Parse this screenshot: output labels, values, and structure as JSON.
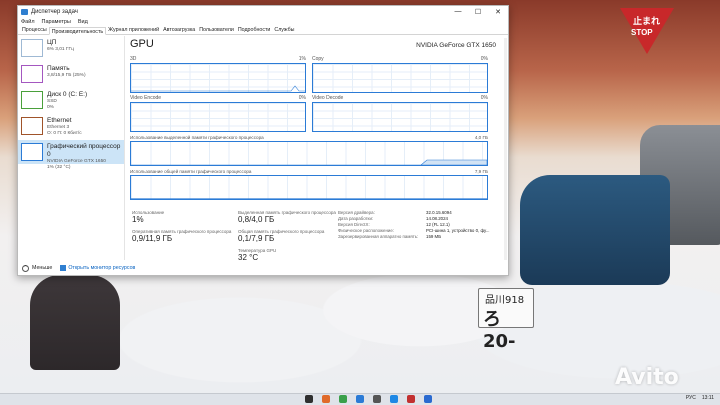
{
  "window": {
    "title": "Диспетчер задач"
  },
  "menu": [
    "Файл",
    "Параметры",
    "Вид"
  ],
  "tabs": [
    "Процессы",
    "Производительность",
    "Журнал приложений",
    "Автозагрузка",
    "Пользователи",
    "Подробности",
    "Службы"
  ],
  "sidebar": {
    "items": [
      {
        "name": "ЦП",
        "detail": "6% 3,01 ГГц"
      },
      {
        "name": "Память",
        "detail": "3,8/15,9 ГБ (25%)"
      },
      {
        "name": "Диск 0 (C: E:)",
        "detail": "SSD",
        "detail2": "0%"
      },
      {
        "name": "Ethernet",
        "detail": "Ethernet 3",
        "detail2": "О: 0 П: 0 Кбит/с"
      },
      {
        "name": "Графический процессор 0",
        "detail": "NVIDIA GeForce GTX 1650",
        "detail2": "1% (32 °C)"
      }
    ]
  },
  "main": {
    "title": "GPU",
    "model": "NVIDIA GeForce GTX 1650",
    "engines": [
      {
        "name": "3D",
        "pct": "1%"
      },
      {
        "name": "Copy",
        "pct": "0%"
      },
      {
        "name": "Video Encode",
        "pct": "0%"
      },
      {
        "name": "Video Decode",
        "pct": "0%"
      }
    ],
    "dedicated_label": "Использование выделенной памяти графического процессора",
    "dedicated_max": "4,0 ГБ",
    "shared_label": "Использование общей памяти графического процессора",
    "shared_max": "7,9 ГБ"
  },
  "stats": {
    "usage_label": "Использование",
    "usage": "1%",
    "gpu_mem_label": "Оперативная память графического процессора",
    "gpu_mem": "0,9/11,9 ГБ",
    "ded_label": "Выделенная память графического процессора",
    "ded": "0,8/4,0 ГБ",
    "shared_label": "Общая память графического процессора",
    "shared": "0,1/7,9 ГБ",
    "temp_label": "Температура GPU",
    "temp": "32 °C"
  },
  "props": [
    {
      "k": "Версия драйвера:",
      "v": "32.0.15.6094"
    },
    {
      "k": "Дата разработки:",
      "v": "14.08.2024"
    },
    {
      "k": "Версия DirectX:",
      "v": "12 (FL 12.1)"
    },
    {
      "k": "Физическое расположение:",
      "v": "PCI-шина 1, устройство 0, фу..."
    },
    {
      "k": "Зарезервированная аппаратно память:",
      "v": "159 МБ"
    }
  ],
  "footer": {
    "less": "Меньше",
    "monitor": "Открыть монитор ресурсов"
  },
  "taskbar": {
    "lang": "РУС",
    "time": "13:11"
  },
  "wallpaper": {
    "plate1": "品川918",
    "plate2": "ろ20-",
    "sign1": "止まれ",
    "sign2": "STOP",
    "watermark": "Avito"
  }
}
